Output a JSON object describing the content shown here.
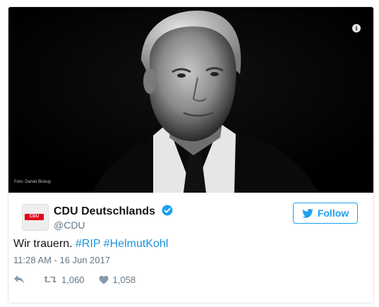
{
  "photo": {
    "credit": "Foto: Daniel Biskup"
  },
  "account": {
    "avatar_text": "CDU",
    "display_name": "CDU Deutschlands",
    "handle": "@CDU"
  },
  "follow_label": "Follow",
  "tweet": {
    "text": "Wir trauern.",
    "hashtags": [
      "#RIP",
      "#HelmutKohl"
    ],
    "timestamp": "11:28 AM - 16 Jun 2017"
  },
  "stats": {
    "retweets": "1,060",
    "likes": "1,058"
  },
  "colors": {
    "accent": "#1da1f2",
    "brand_red": "#e2001a"
  }
}
